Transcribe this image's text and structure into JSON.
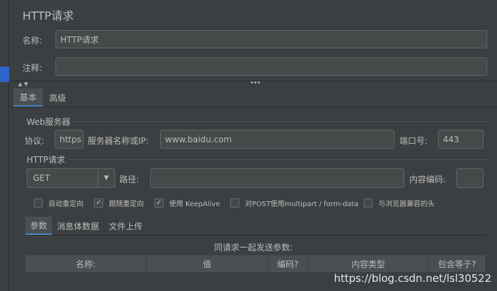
{
  "panel_title": "HTTP请求",
  "name": {
    "label": "名称:",
    "value": "HTTP请求"
  },
  "comment": {
    "label": "注释:",
    "value": ""
  },
  "top_tabs": [
    {
      "label": "基本",
      "active": true
    },
    {
      "label": "高级",
      "active": false
    }
  ],
  "web_server": {
    "section_title": "Web服务器",
    "protocol_label": "协议:",
    "protocol_value": "https",
    "server_label": "服务器名称或IP:",
    "server_value": "www.baidu.com",
    "port_label": "端口号:",
    "port_value": "443"
  },
  "http_request": {
    "section_title": "HTTP请求",
    "method": "GET",
    "path_label": "路径:",
    "path_value": "",
    "encoding_label": "内容编码:",
    "encoding_value": ""
  },
  "options": [
    {
      "label": "自动重定向",
      "checked": false
    },
    {
      "label": "跟随重定向",
      "checked": true
    },
    {
      "label": "使用 KeepAlive",
      "checked": true
    },
    {
      "label": "对POST使用multipart / form-data",
      "checked": false
    },
    {
      "label": "与浏览器兼容的头",
      "checked": false
    }
  ],
  "param_tabs": [
    {
      "label": "参数",
      "active": true
    },
    {
      "label": "消息体数据",
      "active": false
    },
    {
      "label": "文件上传",
      "active": false
    }
  ],
  "params_caption": "同请求一起发送参数:",
  "table_columns": [
    "名称:",
    "值",
    "编码?",
    "内容类型",
    "包含等于?"
  ],
  "check_mark": "✓",
  "watermark": "https://blog.csdn.net/lsl30522"
}
